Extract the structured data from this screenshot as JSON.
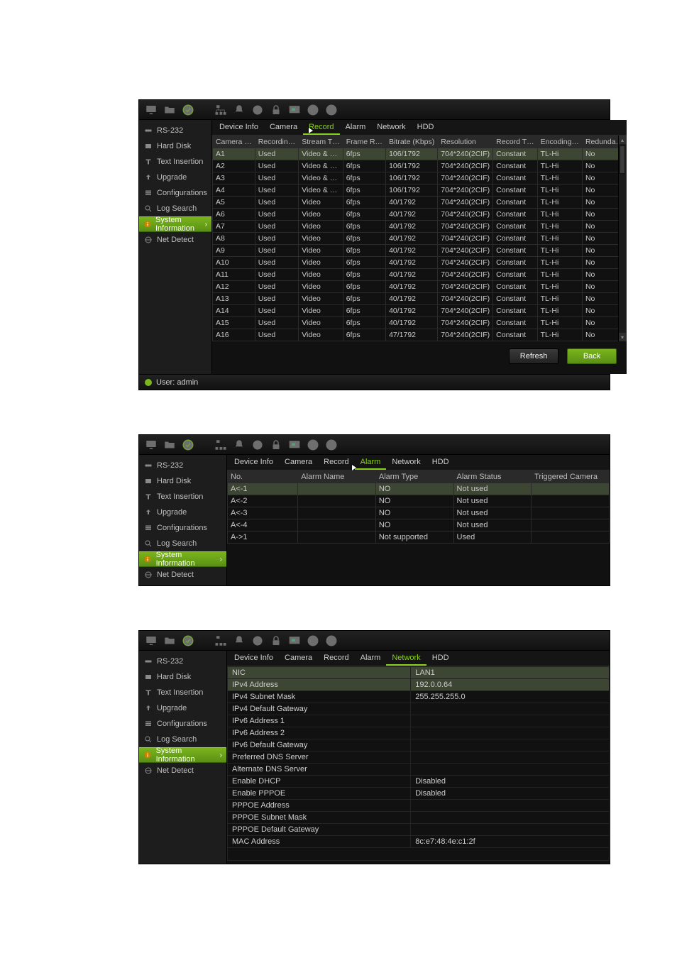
{
  "sidebar": {
    "items": [
      {
        "label": "RS-232"
      },
      {
        "label": "Hard Disk"
      },
      {
        "label": "Text Insertion"
      },
      {
        "label": "Upgrade"
      },
      {
        "label": "Configurations"
      },
      {
        "label": "Log Search"
      },
      {
        "label": "System Information"
      },
      {
        "label": "Net Detect"
      }
    ]
  },
  "statusbar": {
    "user_label": "User: admin"
  },
  "panel1": {
    "tabs": [
      "Device Info",
      "Camera",
      "Record",
      "Alarm",
      "Network",
      "HDD"
    ],
    "active_tab": "Record",
    "headers": [
      "Camera …",
      "Recordin…",
      "Stream T…",
      "Frame R…",
      "Bitrate (Kbps)",
      "Resolution",
      "Record T…",
      "Encoding…",
      "Redunda…"
    ],
    "rows": [
      {
        "c": "A1",
        "r": "Used",
        "s": "Video & …",
        "f": "6fps",
        "b": "106/1792",
        "res": "704*240(2CIF)",
        "rt": "Constant",
        "enc": "TL-Hi",
        "red": "No",
        "sel": true
      },
      {
        "c": "A2",
        "r": "Used",
        "s": "Video & …",
        "f": "6fps",
        "b": "106/1792",
        "res": "704*240(2CIF)",
        "rt": "Constant",
        "enc": "TL-Hi",
        "red": "No"
      },
      {
        "c": "A3",
        "r": "Used",
        "s": "Video & …",
        "f": "6fps",
        "b": "106/1792",
        "res": "704*240(2CIF)",
        "rt": "Constant",
        "enc": "TL-Hi",
        "red": "No"
      },
      {
        "c": "A4",
        "r": "Used",
        "s": "Video & …",
        "f": "6fps",
        "b": "106/1792",
        "res": "704*240(2CIF)",
        "rt": "Constant",
        "enc": "TL-Hi",
        "red": "No"
      },
      {
        "c": "A5",
        "r": "Used",
        "s": "Video",
        "f": "6fps",
        "b": "40/1792",
        "res": "704*240(2CIF)",
        "rt": "Constant",
        "enc": "TL-Hi",
        "red": "No"
      },
      {
        "c": "A6",
        "r": "Used",
        "s": "Video",
        "f": "6fps",
        "b": "40/1792",
        "res": "704*240(2CIF)",
        "rt": "Constant",
        "enc": "TL-Hi",
        "red": "No"
      },
      {
        "c": "A7",
        "r": "Used",
        "s": "Video",
        "f": "6fps",
        "b": "40/1792",
        "res": "704*240(2CIF)",
        "rt": "Constant",
        "enc": "TL-Hi",
        "red": "No"
      },
      {
        "c": "A8",
        "r": "Used",
        "s": "Video",
        "f": "6fps",
        "b": "40/1792",
        "res": "704*240(2CIF)",
        "rt": "Constant",
        "enc": "TL-Hi",
        "red": "No"
      },
      {
        "c": "A9",
        "r": "Used",
        "s": "Video",
        "f": "6fps",
        "b": "40/1792",
        "res": "704*240(2CIF)",
        "rt": "Constant",
        "enc": "TL-Hi",
        "red": "No"
      },
      {
        "c": "A10",
        "r": "Used",
        "s": "Video",
        "f": "6fps",
        "b": "40/1792",
        "res": "704*240(2CIF)",
        "rt": "Constant",
        "enc": "TL-Hi",
        "red": "No"
      },
      {
        "c": "A11",
        "r": "Used",
        "s": "Video",
        "f": "6fps",
        "b": "40/1792",
        "res": "704*240(2CIF)",
        "rt": "Constant",
        "enc": "TL-Hi",
        "red": "No"
      },
      {
        "c": "A12",
        "r": "Used",
        "s": "Video",
        "f": "6fps",
        "b": "40/1792",
        "res": "704*240(2CIF)",
        "rt": "Constant",
        "enc": "TL-Hi",
        "red": "No"
      },
      {
        "c": "A13",
        "r": "Used",
        "s": "Video",
        "f": "6fps",
        "b": "40/1792",
        "res": "704*240(2CIF)",
        "rt": "Constant",
        "enc": "TL-Hi",
        "red": "No"
      },
      {
        "c": "A14",
        "r": "Used",
        "s": "Video",
        "f": "6fps",
        "b": "40/1792",
        "res": "704*240(2CIF)",
        "rt": "Constant",
        "enc": "TL-Hi",
        "red": "No"
      },
      {
        "c": "A15",
        "r": "Used",
        "s": "Video",
        "f": "6fps",
        "b": "40/1792",
        "res": "704*240(2CIF)",
        "rt": "Constant",
        "enc": "TL-Hi",
        "red": "No"
      },
      {
        "c": "A16",
        "r": "Used",
        "s": "Video",
        "f": "6fps",
        "b": "47/1792",
        "res": "704*240(2CIF)",
        "rt": "Constant",
        "enc": "TL-Hi",
        "red": "No"
      }
    ],
    "buttons": {
      "refresh": "Refresh",
      "back": "Back"
    }
  },
  "panel2": {
    "tabs": [
      "Device Info",
      "Camera",
      "Record",
      "Alarm",
      "Network",
      "HDD"
    ],
    "active_tab": "Alarm",
    "headers": [
      "No.",
      "Alarm Name",
      "Alarm Type",
      "Alarm Status",
      "Triggered Camera"
    ],
    "rows": [
      {
        "no": "A<-1",
        "name": "",
        "type": "NO",
        "status": "Not used",
        "trig": "",
        "sel": true
      },
      {
        "no": "A<-2",
        "name": "",
        "type": "NO",
        "status": "Not used",
        "trig": ""
      },
      {
        "no": "A<-3",
        "name": "",
        "type": "NO",
        "status": "Not used",
        "trig": ""
      },
      {
        "no": "A<-4",
        "name": "",
        "type": "NO",
        "status": "Not used",
        "trig": ""
      },
      {
        "no": "A->1",
        "name": "",
        "type": "Not supported",
        "status": "Used",
        "trig": ""
      }
    ]
  },
  "panel3": {
    "tabs": [
      "Device Info",
      "Camera",
      "Record",
      "Alarm",
      "Network",
      "HDD"
    ],
    "active_tab": "Network",
    "rows": [
      {
        "k": "NIC",
        "v": "LAN1",
        "sel": true
      },
      {
        "k": "IPv4 Address",
        "v": "192.0.0.64",
        "sel": true
      },
      {
        "k": "IPv4 Subnet Mask",
        "v": "255.255.255.0"
      },
      {
        "k": "IPv4 Default Gateway",
        "v": ""
      },
      {
        "k": "IPv6 Address 1",
        "v": ""
      },
      {
        "k": "IPv6 Address 2",
        "v": ""
      },
      {
        "k": "IPv6 Default Gateway",
        "v": ""
      },
      {
        "k": "Preferred DNS Server",
        "v": ""
      },
      {
        "k": "Alternate DNS Server",
        "v": ""
      },
      {
        "k": "Enable DHCP",
        "v": "Disabled"
      },
      {
        "k": "Enable PPPOE",
        "v": "Disabled"
      },
      {
        "k": "PPPOE Address",
        "v": ""
      },
      {
        "k": "PPPOE Subnet Mask",
        "v": ""
      },
      {
        "k": "PPPOE Default Gateway",
        "v": ""
      },
      {
        "k": "MAC Address",
        "v": "8c:e7:48:4e:c1:2f"
      }
    ]
  }
}
